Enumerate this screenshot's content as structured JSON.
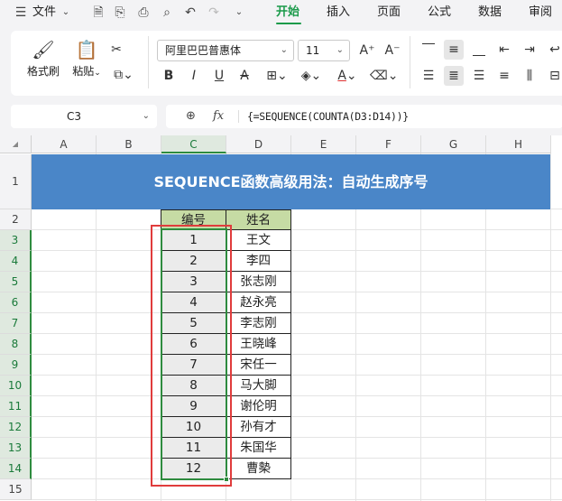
{
  "topbar": {
    "menu_label": "文件",
    "tabs": [
      {
        "label": "开始",
        "active": true
      },
      {
        "label": "插入",
        "active": false
      },
      {
        "label": "页面",
        "active": false
      },
      {
        "label": "公式",
        "active": false
      },
      {
        "label": "数据",
        "active": false
      },
      {
        "label": "审阅",
        "active": false
      }
    ]
  },
  "ribbon": {
    "format_painter_label": "格式刷",
    "paste_label": "粘贴",
    "font_name": "阿里巴巴普惠体",
    "font_size": "11",
    "bold_label": "B",
    "italic_label": "I",
    "underline_label": "U",
    "strike_label": "A",
    "font_color_label": "A",
    "grow_label": "A⁺",
    "shrink_label": "A⁻"
  },
  "formula_bar": {
    "name_box": "C3",
    "fx_label": "fx",
    "formula": "{=SEQUENCE(COUNTA(D3:D14))}"
  },
  "sheet": {
    "columns": [
      "A",
      "B",
      "C",
      "D",
      "E",
      "F",
      "G",
      "H"
    ],
    "active_column": "C",
    "rows": [
      "1",
      "2",
      "3",
      "4",
      "5",
      "6",
      "7",
      "8",
      "9",
      "10",
      "11",
      "12",
      "13",
      "14",
      "15"
    ],
    "title": "SEQUENCE函数高级用法：自动生成序号",
    "header": {
      "seq": "编号",
      "name": "姓名"
    },
    "records": [
      {
        "seq": "1",
        "name": "王文"
      },
      {
        "seq": "2",
        "name": "李四"
      },
      {
        "seq": "3",
        "name": "张志刚"
      },
      {
        "seq": "4",
        "name": "赵永亮"
      },
      {
        "seq": "5",
        "name": "李志刚"
      },
      {
        "seq": "6",
        "name": "王晓峰"
      },
      {
        "seq": "7",
        "name": "宋任一"
      },
      {
        "seq": "8",
        "name": "马大脚"
      },
      {
        "seq": "9",
        "name": "谢伦明"
      },
      {
        "seq": "10",
        "name": "孙有才"
      },
      {
        "seq": "11",
        "name": "朱国华"
      },
      {
        "seq": "12",
        "name": "曹槷"
      }
    ]
  },
  "colors": {
    "accent": "#1a9a4a",
    "title_fill": "#4a86c8",
    "header_fill": "#c6dba4",
    "number_fill": "#ebebeb",
    "selection": "#2e8b3e",
    "highlight": "#e03c3c"
  }
}
